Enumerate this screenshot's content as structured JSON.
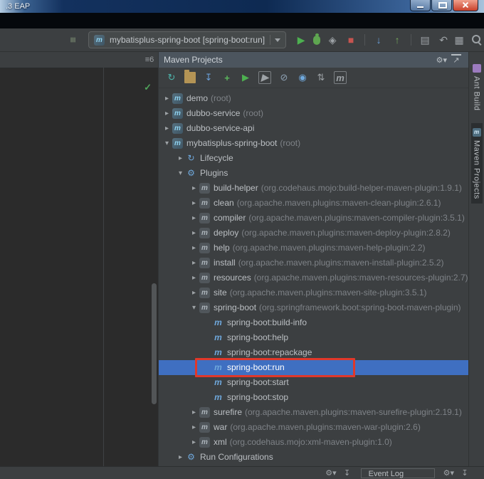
{
  "colors": {
    "selection_blue": "#3f6fc1",
    "annotation_red": "#e0382a",
    "run_green": "#4db050",
    "titlebar_navy": "#0e2a52"
  },
  "title_bar": {
    "title": ".3 EAP"
  },
  "toolbar": {
    "run_config_icon": "m",
    "run_config_value": "mybatisplus-spring-boot [spring-boot:run]",
    "left_icons": [
      {
        "name": "tool-buttons-icon",
        "glyph": "≡",
        "color": "#8ba07f",
        "cls": "rot90"
      }
    ],
    "right_icons": [
      {
        "name": "run-icon",
        "glyph": "▶",
        "color": "#4db050"
      },
      {
        "name": "debug-icon",
        "glyph": "",
        "cls": "bug"
      },
      {
        "name": "coverage-icon",
        "glyph": "◈",
        "color": "#9da2a6"
      },
      {
        "name": "stop-icon",
        "glyph": "■",
        "color": "#c75450"
      },
      {
        "name": "separator",
        "cls": "sep"
      },
      {
        "name": "vcs-update-icon",
        "glyph": "↓",
        "color": "#6a9fd8"
      },
      {
        "name": "vcs-commit-icon",
        "glyph": "↑",
        "color": "#76a75d"
      },
      {
        "name": "separator",
        "cls": "sep"
      },
      {
        "name": "diff-icon",
        "glyph": "▤",
        "color": "#9da2a6"
      },
      {
        "name": "rollback-icon",
        "glyph": "↶",
        "color": "#9da2a6"
      },
      {
        "name": "restore-layout-icon",
        "glyph": "▦",
        "color": "#9da2a6",
        "cls": "push"
      },
      {
        "name": "search-icon",
        "glyph": "",
        "cls": "css-search"
      }
    ]
  },
  "editor": {
    "header_icons": [
      {
        "name": "hidden-tabs-icon",
        "glyph": "≡6",
        "color": "#9da2a6"
      }
    ],
    "inspection_status": "✓"
  },
  "maven_panel": {
    "title": "Maven Projects",
    "header_icons": [
      {
        "name": "panel-settings-icon",
        "glyph": "⚙▾"
      },
      {
        "name": "hide-panel-icon",
        "glyph": "↗",
        "cls": "hide-ic"
      }
    ],
    "toolbar_icons": [
      {
        "name": "reimport-icon",
        "glyph": "↻",
        "color": "#4db6ac"
      },
      {
        "name": "generate-sources-icon",
        "glyph": "",
        "cls": "folder"
      },
      {
        "name": "download-sources-icon",
        "glyph": "↧",
        "color": "#6a9fd8"
      },
      {
        "name": "add-icon",
        "glyph": "+",
        "color": "#5bb85d",
        "cls": "bold"
      },
      {
        "name": "run-goal-icon",
        "glyph": "▶",
        "color": "#4db050"
      },
      {
        "name": "execute-goal-icon",
        "glyph": "▶",
        "color": "#9da2a6",
        "cls": "boxed"
      },
      {
        "name": "skip-tests-icon",
        "glyph": "⊘",
        "color": "#8fa3b5"
      },
      {
        "name": "dependencies-icon",
        "glyph": "◉",
        "color": "#6fa8dc"
      },
      {
        "name": "collapse-all-icon",
        "glyph": "⇅",
        "color": "#9da2a6"
      },
      {
        "name": "maven-settings-icon",
        "glyph": "m",
        "color": "#9da2a6",
        "cls": "boxed"
      }
    ],
    "tree": [
      {
        "indent": 0,
        "arrow": "collapsed",
        "icon": "maven-project",
        "label": "demo",
        "dim": "(root)"
      },
      {
        "indent": 0,
        "arrow": "collapsed",
        "icon": "maven-project",
        "label": "dubbo-service",
        "dim": "(root)"
      },
      {
        "indent": 0,
        "arrow": "collapsed",
        "icon": "maven-project",
        "label": "dubbo-service-api",
        "dim": ""
      },
      {
        "indent": 0,
        "arrow": "expanded",
        "icon": "maven-project",
        "label": "mybatisplus-spring-boot",
        "dim": "(root)"
      },
      {
        "indent": 1,
        "arrow": "collapsed",
        "icon": "lifecycle",
        "label": "Lifecycle",
        "dim": ""
      },
      {
        "indent": 1,
        "arrow": "expanded",
        "icon": "plugins",
        "label": "Plugins",
        "dim": ""
      },
      {
        "indent": 2,
        "arrow": "collapsed",
        "icon": "plugin",
        "label": "build-helper",
        "dim": "(org.codehaus.mojo:build-helper-maven-plugin:1.9.1)"
      },
      {
        "indent": 2,
        "arrow": "collapsed",
        "icon": "plugin",
        "label": "clean",
        "dim": "(org.apache.maven.plugins:maven-clean-plugin:2.6.1)"
      },
      {
        "indent": 2,
        "arrow": "collapsed",
        "icon": "plugin",
        "label": "compiler",
        "dim": "(org.apache.maven.plugins:maven-compiler-plugin:3.5.1)"
      },
      {
        "indent": 2,
        "arrow": "collapsed",
        "icon": "plugin",
        "label": "deploy",
        "dim": "(org.apache.maven.plugins:maven-deploy-plugin:2.8.2)"
      },
      {
        "indent": 2,
        "arrow": "collapsed",
        "icon": "plugin",
        "label": "help",
        "dim": "(org.apache.maven.plugins:maven-help-plugin:2.2)"
      },
      {
        "indent": 2,
        "arrow": "collapsed",
        "icon": "plugin",
        "label": "install",
        "dim": "(org.apache.maven.plugins:maven-install-plugin:2.5.2)"
      },
      {
        "indent": 2,
        "arrow": "collapsed",
        "icon": "plugin",
        "label": "resources",
        "dim": "(org.apache.maven.plugins:maven-resources-plugin:2.7)"
      },
      {
        "indent": 2,
        "arrow": "collapsed",
        "icon": "plugin",
        "label": "site",
        "dim": "(org.apache.maven.plugins:maven-site-plugin:3.5.1)"
      },
      {
        "indent": 2,
        "arrow": "expanded",
        "icon": "plugin",
        "label": "spring-boot",
        "dim": "(org.springframework.boot:spring-boot-maven-plugin)"
      },
      {
        "indent": 3,
        "arrow": "none",
        "icon": "goal",
        "label": "spring-boot:build-info",
        "dim": ""
      },
      {
        "indent": 3,
        "arrow": "none",
        "icon": "goal",
        "label": "spring-boot:help",
        "dim": ""
      },
      {
        "indent": 3,
        "arrow": "none",
        "icon": "goal",
        "label": "spring-boot:repackage",
        "dim": ""
      },
      {
        "indent": 3,
        "arrow": "none",
        "icon": "goal",
        "label": "spring-boot:run",
        "dim": "",
        "selected": true,
        "annotated": true
      },
      {
        "indent": 3,
        "arrow": "none",
        "icon": "goal",
        "label": "spring-boot:start",
        "dim": ""
      },
      {
        "indent": 3,
        "arrow": "none",
        "icon": "goal",
        "label": "spring-boot:stop",
        "dim": ""
      },
      {
        "indent": 2,
        "arrow": "collapsed",
        "icon": "plugin",
        "label": "surefire",
        "dim": "(org.apache.maven.plugins:maven-surefire-plugin:2.19.1)"
      },
      {
        "indent": 2,
        "arrow": "collapsed",
        "icon": "plugin",
        "label": "war",
        "dim": "(org.apache.maven.plugins:maven-war-plugin:2.6)"
      },
      {
        "indent": 2,
        "arrow": "collapsed",
        "icon": "plugin",
        "label": "xml",
        "dim": "(org.codehaus.mojo:xml-maven-plugin:1.0)"
      },
      {
        "indent": 1,
        "arrow": "collapsed",
        "icon": "run-configurations",
        "label": "Run Configurations",
        "dim": ""
      }
    ]
  },
  "right_toolbar": {
    "items": [
      {
        "label": "Ant Build",
        "icon_name": "ant-build-icon",
        "icon_color": "#9c7bbf",
        "icon_letter": "",
        "active": false
      },
      {
        "label": "Maven Projects",
        "icon_name": "maven-icon",
        "icon_color": "#4e6d7f",
        "icon_letter": "m",
        "active": true
      }
    ]
  },
  "status_bar": {
    "left_icons": [
      {
        "name": "statusbar-settings-icon",
        "glyph": "⚙▾"
      },
      {
        "name": "statusbar-import-icon",
        "glyph": "↧"
      }
    ],
    "event_log_label": "Event Log",
    "right_icons": [
      {
        "name": "eventlog-settings-icon",
        "glyph": "⚙▾"
      },
      {
        "name": "eventlog-import-icon",
        "glyph": "↧"
      }
    ]
  }
}
